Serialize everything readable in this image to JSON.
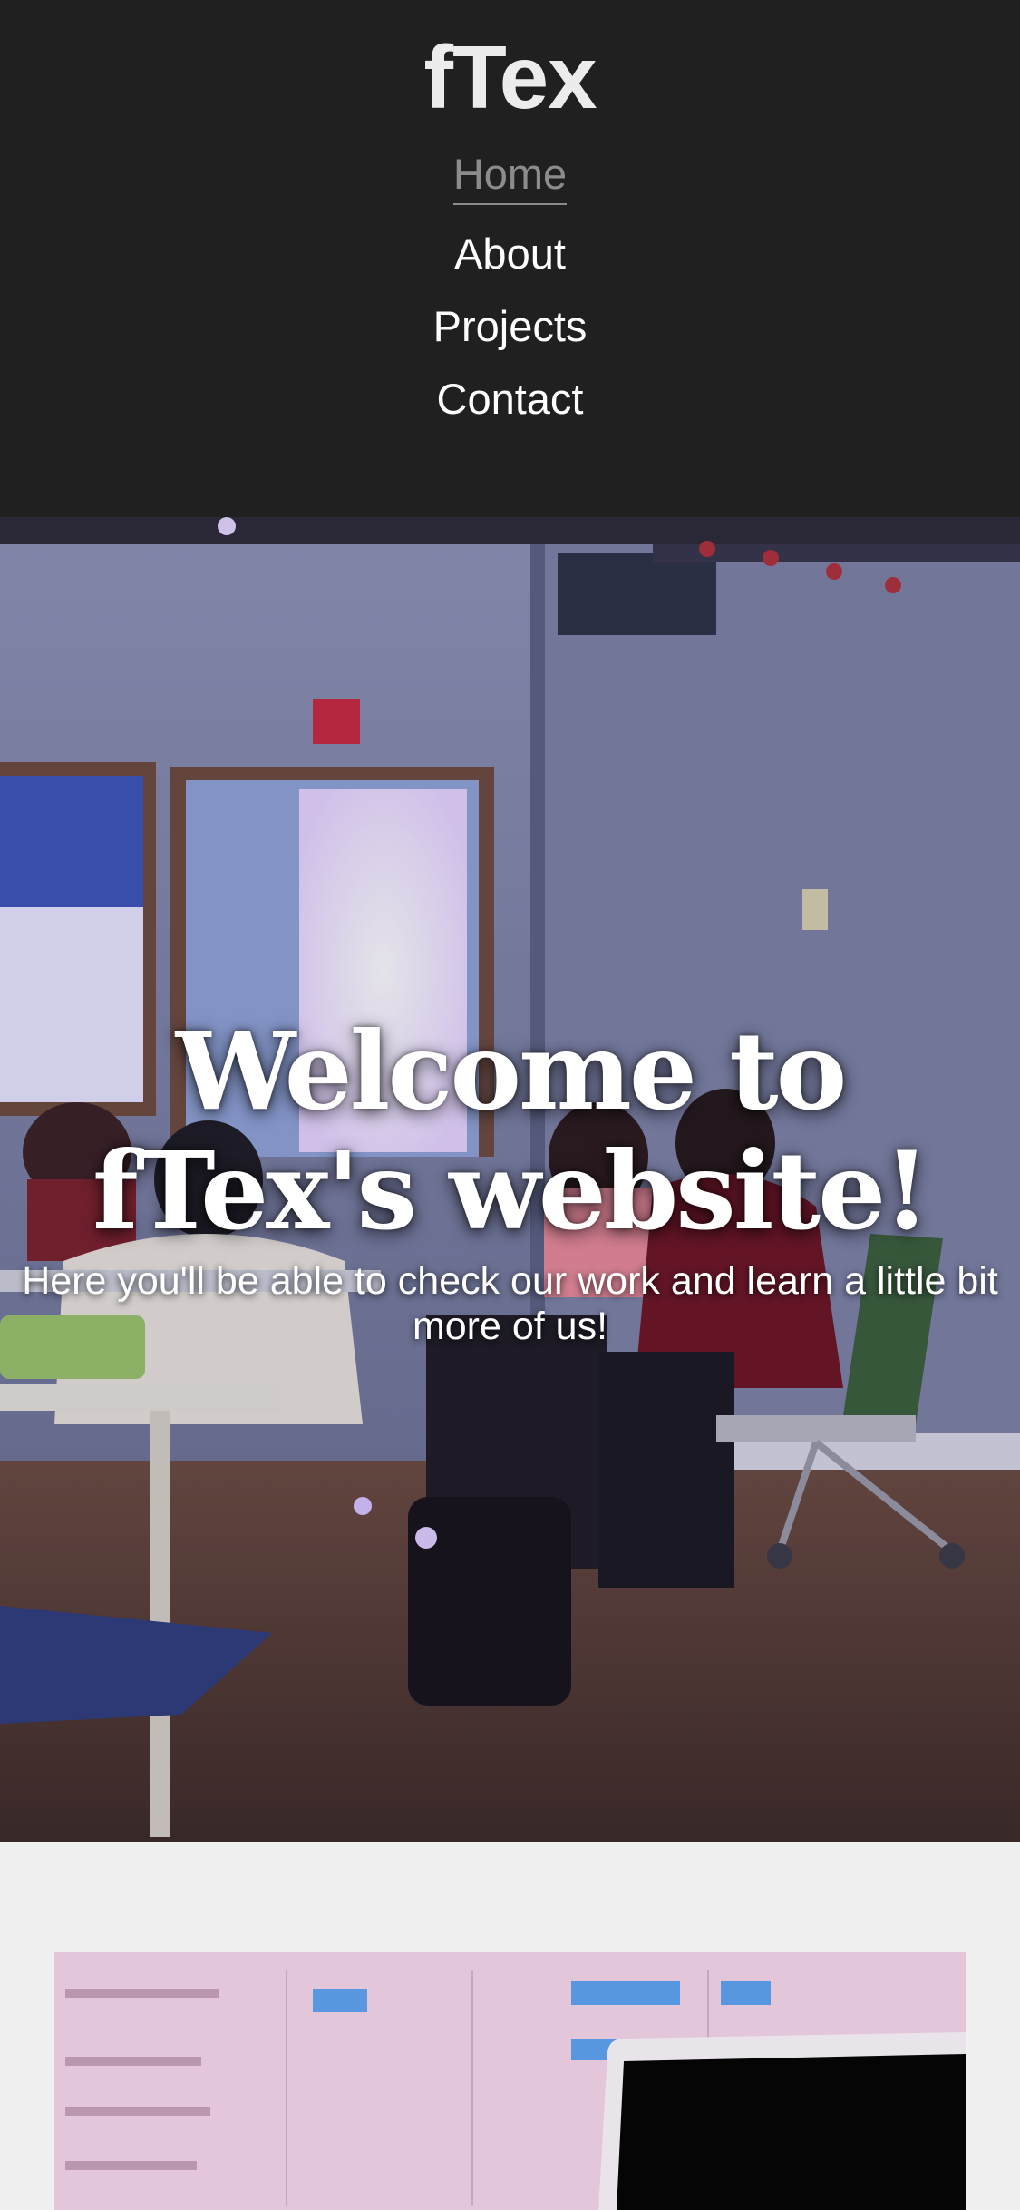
{
  "header": {
    "logo": "fTex",
    "nav": [
      {
        "label": "Home",
        "active": true
      },
      {
        "label": "About",
        "active": false
      },
      {
        "label": "Projects",
        "active": false
      },
      {
        "label": "Contact",
        "active": false
      }
    ]
  },
  "hero": {
    "title": "Welcome to fTex's website!",
    "subtitle": "Here you'll be able to check our work and learn a little bit more of us!"
  },
  "colors": {
    "header_bg": "#202020",
    "nav_active": "#8c8c8c",
    "page_bg": "#f0f0f0"
  }
}
